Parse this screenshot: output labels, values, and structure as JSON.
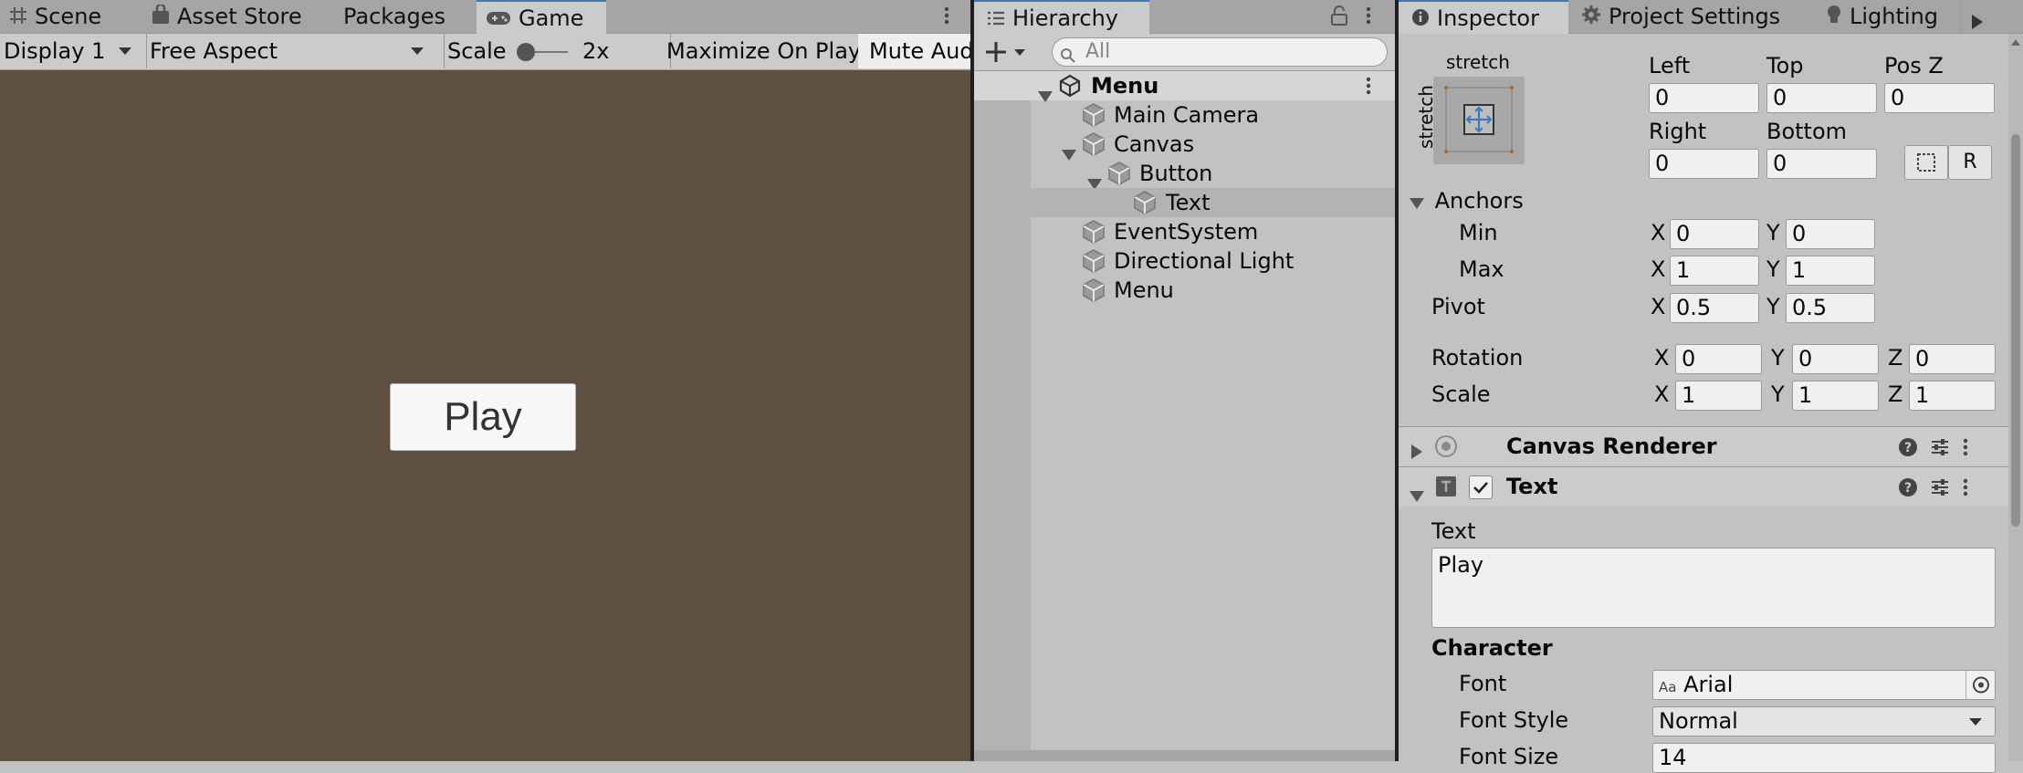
{
  "game_panel": {
    "tabs": [
      {
        "label": "Scene",
        "icon": "grid-icon"
      },
      {
        "label": "Asset Store",
        "icon": "bag-icon"
      },
      {
        "label": "Packages",
        "icon": ""
      },
      {
        "label": "Game",
        "icon": "gamepad-icon",
        "active": true
      }
    ],
    "toolbar": {
      "display": "Display 1",
      "aspect": "Free Aspect",
      "scale_label": "Scale",
      "scale_value": "2x",
      "maximize": "Maximize On Play",
      "mute": "Mute Audio"
    },
    "viewport_color": "#5d5040",
    "play_button_label": "Play"
  },
  "hierarchy": {
    "tab_label": "Hierarchy",
    "search_placeholder": "All",
    "scene": "Menu",
    "items": [
      {
        "label": "Main Camera"
      },
      {
        "label": "Canvas"
      },
      {
        "label": "Button"
      },
      {
        "label": "Text"
      },
      {
        "label": "EventSystem"
      },
      {
        "label": "Directional Light"
      },
      {
        "label": "Menu"
      }
    ]
  },
  "inspector": {
    "tabs": [
      {
        "label": "Inspector",
        "icon": "info-icon"
      },
      {
        "label": "Project Settings",
        "icon": "gear-icon"
      },
      {
        "label": "Lighting",
        "icon": "bulb-icon"
      }
    ],
    "rect": {
      "anchor_top_label": "stretch",
      "anchor_side_label": "stretch",
      "left_label": "Left",
      "left": "0",
      "top_label": "Top",
      "top": "0",
      "posz_label": "Pos Z",
      "posz": "0",
      "right_label": "Right",
      "right": "0",
      "bottom_label": "Bottom",
      "bottom": "0",
      "raw_button": "R"
    },
    "anchors": {
      "label": "Anchors",
      "min_label": "Min",
      "min_x": "0",
      "min_y": "0",
      "max_label": "Max",
      "max_x": "1",
      "max_y": "1"
    },
    "pivot": {
      "label": "Pivot",
      "x": "0.5",
      "y": "0.5"
    },
    "rotation": {
      "label": "Rotation",
      "x": "0",
      "y": "0",
      "z": "0"
    },
    "scale": {
      "label": "Scale",
      "x": "1",
      "y": "1",
      "z": "1"
    },
    "axis": {
      "x": "X",
      "y": "Y",
      "z": "Z"
    },
    "canvas_renderer": {
      "title": "Canvas Renderer"
    },
    "text_component": {
      "title": "Text",
      "text_label": "Text",
      "text_value": "Play",
      "character_label": "Character",
      "font_label": "Font",
      "font_prefix": "Aa",
      "font_value": "Arial",
      "font_style_label": "Font Style",
      "font_style_value": "Normal",
      "font_size_label": "Font Size",
      "font_size_value": "14"
    }
  }
}
